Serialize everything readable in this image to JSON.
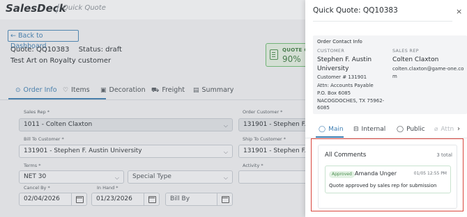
{
  "app": {
    "logo": "SalesDeck",
    "separator": "/",
    "breadcrumb": "Quick Quote"
  },
  "header": {
    "back_label": "← Back to Dashboard",
    "quote_id": "Quote: QQ10383",
    "status": "Status: draft",
    "customer": "Test Art on Royalty customer",
    "quote_card": {
      "label": "QUOTE C",
      "value": "90%"
    }
  },
  "tabs": [
    {
      "label": "Order Info",
      "icon": "⊙",
      "active": true
    },
    {
      "label": "Items",
      "icon": "♡"
    },
    {
      "label": "Decoration",
      "icon": "▣"
    },
    {
      "label": "Freight",
      "icon": "⛟"
    },
    {
      "label": "Summary",
      "icon": "▤"
    }
  ],
  "form": {
    "sales_rep": {
      "label": "Sales Rep *",
      "value": "1011 - Colten Claxton"
    },
    "order_customer": {
      "label": "Order Customer *",
      "value": "131901 - Stephen F. Aus"
    },
    "bill_to": {
      "label": "Bill To Customer *",
      "value": "131901 - Stephen F. Austin University"
    },
    "ship_to": {
      "label": "Ship To Customer *",
      "value": "131901 - Stephen F. Aus"
    },
    "terms": {
      "label": "Terms *",
      "value": "NET 30"
    },
    "special_type": {
      "value": "Special Type"
    },
    "activity": {
      "label": "Activity *",
      "value": ""
    },
    "cancel_by": {
      "label": "Cancel By *",
      "value": "02/04/2026"
    },
    "in_hand": {
      "label": "In Hand *",
      "value": "01/23/2026"
    },
    "bill_by": {
      "value": "Bill By"
    }
  },
  "panel": {
    "title": "Quick Quote: QQ10383",
    "close": "×",
    "contact": {
      "heading": "Order Contact Info",
      "customer_label": "CUSTOMER",
      "customer_name": "Stephen F. Austin University",
      "customer_number": "Customer # 131901",
      "address": [
        "Attn: Accounts Payable",
        "P.O. Box 6085",
        "NACOGDOCHES, TX 75962-",
        "6085"
      ],
      "rep_label": "SALES REP",
      "rep_name": "Colten Claxton",
      "rep_email": "colten.claxton@game-one.com"
    },
    "tabs": [
      {
        "label": "Main",
        "icon": "◯",
        "active": true
      },
      {
        "label": "Internal",
        "icon": "⊟"
      },
      {
        "label": "Public",
        "icon": "◯"
      },
      {
        "label": "Attn",
        "icon": "⌀"
      }
    ],
    "comments": {
      "title": "All Comments",
      "count": "3 total",
      "items": [
        {
          "badge": "Approved",
          "author": "Amanda Unger",
          "time": "01/05 12:55 PM",
          "text": "Quote approved by sales rep for submission"
        }
      ]
    }
  },
  "colors": {
    "accent": "#3f7fb3",
    "success": "#4c8f4f",
    "highlight": "#d9453c"
  }
}
